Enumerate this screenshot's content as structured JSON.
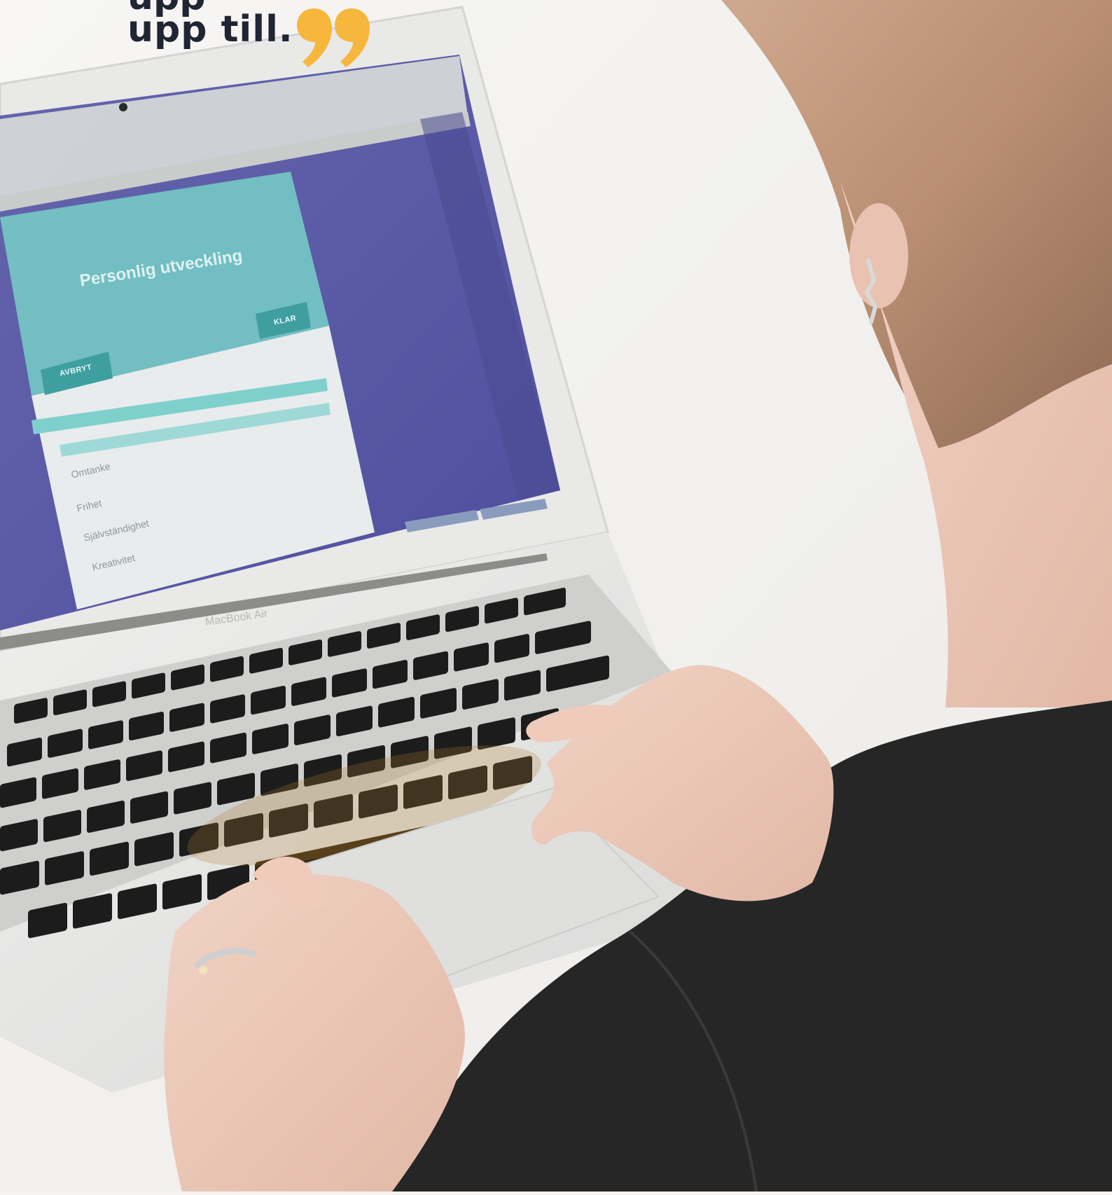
{
  "caption": {
    "line_partial": "upp",
    "line_main": "upp till."
  },
  "colors": {
    "quote_mark": "#f6b73c",
    "caption_text": "#1f2533",
    "screen_background": "#5a5aa8",
    "modal_teal": "#6cc3c2"
  },
  "laptop": {
    "brand": "MacBook Air"
  },
  "screen": {
    "modal_title": "Personlig utveckling",
    "confirm_button": "KLAR",
    "cancel_button": "AVBRYT",
    "options": [
      "Omtanke",
      "Frihet",
      "Självständighet",
      "Kreativitet"
    ]
  }
}
